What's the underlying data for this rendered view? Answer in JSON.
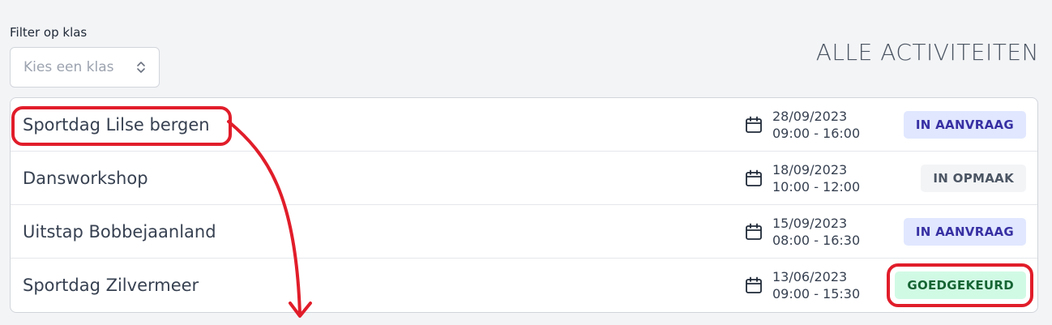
{
  "filter": {
    "label": "Filter op klas",
    "placeholder": "Kies een klas",
    "icon": "chevron-up-down-icon"
  },
  "page_title": "ALLE ACTIVITEITEN",
  "activities": [
    {
      "name": "Sportdag Lilse bergen",
      "date": "28/09/2023",
      "time": "09:00 - 16:00",
      "status": "IN AANVRAAG",
      "status_color": "#3730a3"
    },
    {
      "name": "Dansworkshop",
      "date": "18/09/2023",
      "time": "10:00 - 12:00",
      "status": "IN OPMAAK",
      "status_color": "#4b5563"
    },
    {
      "name": "Uitstap Bobbejaanland",
      "date": "15/09/2023",
      "time": "08:00 - 16:30",
      "status": "IN AANVRAAG",
      "status_color": "#3730a3"
    },
    {
      "name": "Sportdag Zilvermeer",
      "date": "13/06/2023",
      "time": "09:00 - 15:30",
      "status": "GOEDGEKEURD",
      "status_color": "#166534"
    }
  ],
  "annotation": {
    "color": "#e11d2a"
  }
}
